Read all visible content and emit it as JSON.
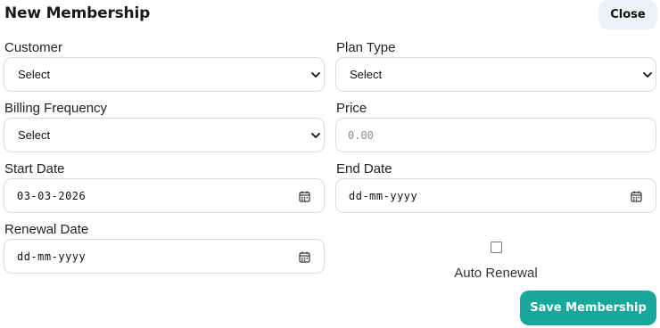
{
  "header": {
    "title": "New Membership",
    "close_label": "Close"
  },
  "form": {
    "customer": {
      "label": "Customer",
      "value": "Select"
    },
    "plan_type": {
      "label": "Plan Type",
      "value": "Select"
    },
    "billing_frequency": {
      "label": "Billing Frequency",
      "value": "Select"
    },
    "price": {
      "label": "Price",
      "placeholder": "0.00"
    },
    "start_date": {
      "label": "Start Date",
      "value": "03-03-2026"
    },
    "end_date": {
      "label": "End Date",
      "value": "dd-mm-yyyy"
    },
    "renewal_date": {
      "label": "Renewal Date",
      "value": "dd-mm-yyyy"
    },
    "auto_renewal": {
      "label": "Auto Renewal",
      "checked": false
    }
  },
  "actions": {
    "save_label": "Save Membership"
  },
  "colors": {
    "accent": "#17a79b",
    "close_bg": "#eef0f8"
  }
}
